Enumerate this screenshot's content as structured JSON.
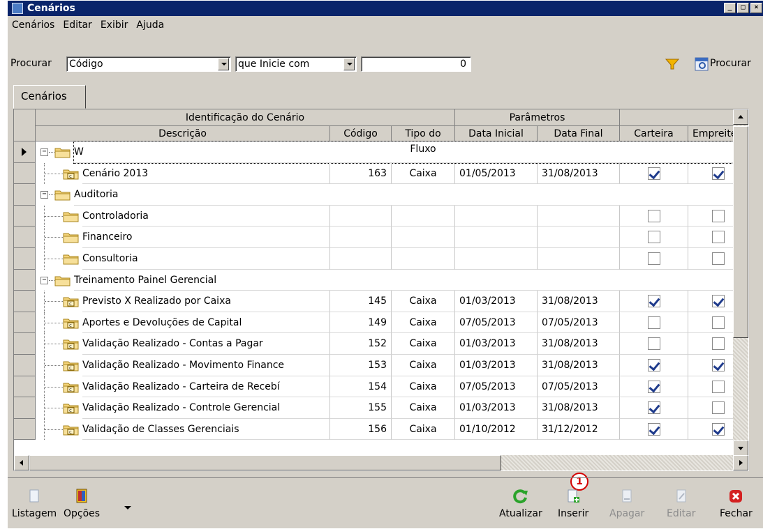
{
  "window": {
    "title": "Cenários"
  },
  "menu": [
    "Cenários",
    "Editar",
    "Exibir",
    "Ajuda"
  ],
  "search": {
    "label": "Procurar",
    "field": "Código",
    "operator": "que Inicie com",
    "value": "0",
    "button": "Procurar"
  },
  "tab": "Cenários",
  "grid": {
    "groups": [
      "Identificação do Cenário",
      "Parâmetros"
    ],
    "columns": [
      "Descrição",
      "Código",
      "Tipo do Fluxo",
      "Data Inicial",
      "Data Final",
      "Carteira",
      "Empreite"
    ],
    "rows": [
      {
        "desc": "W",
        "level": 0,
        "type": "folder",
        "code": "",
        "flow": "",
        "start": "",
        "end": "",
        "carteira": null,
        "emp": null
      },
      {
        "desc": "Cenário 2013",
        "level": 1,
        "type": "scenario",
        "code": "163",
        "flow": "Caixa",
        "start": "01/05/2013",
        "end": "31/08/2013",
        "carteira": true,
        "emp": true
      },
      {
        "desc": "Auditoria",
        "level": 0,
        "type": "folder",
        "code": "",
        "flow": "",
        "start": "",
        "end": "",
        "carteira": null,
        "emp": null
      },
      {
        "desc": "Controladoria",
        "level": 1,
        "type": "folder",
        "code": "",
        "flow": "",
        "start": "",
        "end": "",
        "carteira": false,
        "emp": false
      },
      {
        "desc": "Financeiro",
        "level": 1,
        "type": "folder",
        "code": "",
        "flow": "",
        "start": "",
        "end": "",
        "carteira": false,
        "emp": false
      },
      {
        "desc": "Consultoria",
        "level": 1,
        "type": "folder",
        "code": "",
        "flow": "",
        "start": "",
        "end": "",
        "carteira": false,
        "emp": false
      },
      {
        "desc": "Treinamento Painel Gerencial",
        "level": 0,
        "type": "folder",
        "code": "",
        "flow": "",
        "start": "",
        "end": "",
        "carteira": null,
        "emp": null
      },
      {
        "desc": "Previsto X Realizado por Caixa",
        "level": 1,
        "type": "scenario",
        "code": "145",
        "flow": "Caixa",
        "start": "01/03/2013",
        "end": "31/08/2013",
        "carteira": true,
        "emp": true
      },
      {
        "desc": "Aportes e Devoluções de Capital",
        "level": 1,
        "type": "scenario",
        "code": "149",
        "flow": "Caixa",
        "start": "07/05/2013",
        "end": "07/05/2013",
        "carteira": false,
        "emp": false
      },
      {
        "desc": "Validação Realizado - Contas a Pagar",
        "level": 1,
        "type": "scenario",
        "code": "152",
        "flow": "Caixa",
        "start": "01/03/2013",
        "end": "31/08/2013",
        "carteira": false,
        "emp": false
      },
      {
        "desc": "Validação Realizado - Movimento Finance",
        "level": 1,
        "type": "scenario",
        "code": "153",
        "flow": "Caixa",
        "start": "01/03/2013",
        "end": "31/08/2013",
        "carteira": true,
        "emp": true
      },
      {
        "desc": "Validação Realizado - Carteira de Recebí",
        "level": 1,
        "type": "scenario",
        "code": "154",
        "flow": "Caixa",
        "start": "07/05/2013",
        "end": "07/05/2013",
        "carteira": true,
        "emp": false
      },
      {
        "desc": "Validação Realizado - Controle Gerencial",
        "level": 1,
        "type": "scenario",
        "code": "155",
        "flow": "Caixa",
        "start": "01/03/2013",
        "end": "31/08/2013",
        "carteira": true,
        "emp": false
      },
      {
        "desc": "Validação de Classes Gerenciais",
        "level": 1,
        "type": "scenario",
        "code": "156",
        "flow": "Caixa",
        "start": "01/10/2012",
        "end": "31/12/2012",
        "carteira": true,
        "emp": true
      }
    ]
  },
  "marker": "1",
  "bottom": {
    "listagem": "Listagem",
    "opcoes": "Opções",
    "atualizar": "Atualizar",
    "inserir": "Inserir",
    "apagar": "Apagar",
    "editar": "Editar",
    "fechar": "Fechar"
  },
  "colors": {
    "title_bar": "#0a246a",
    "face": "#d4d0c8",
    "check": "#1f3b8c",
    "marker": "#d40000"
  }
}
